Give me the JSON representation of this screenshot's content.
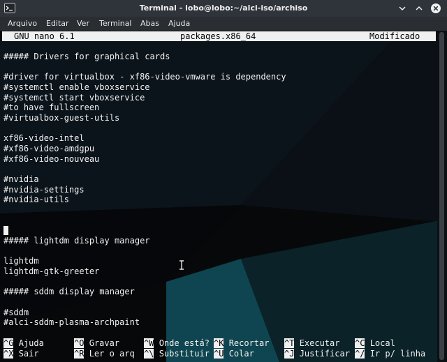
{
  "window": {
    "title": "Terminal - lobo@lobo:~/alci-iso/archiso"
  },
  "menubar": {
    "items": [
      "Arquivo",
      "Editar",
      "Ver",
      "Terminal",
      "Abas",
      "Ajuda"
    ]
  },
  "nano": {
    "version": "GNU nano 6.1",
    "filename": "packages.x86_64",
    "status": "Modificado"
  },
  "file_lines": [
    "##### Drivers for graphical cards",
    "",
    "#driver for virtualbox - xf86-video-vmware is dependency",
    "#systemctl enable vboxservice",
    "#systemctl start vboxservice",
    "#to have fullscreen",
    "#virtualbox-guest-utils",
    "",
    "xf86-video-intel",
    "#xf86-video-amdgpu",
    "#xf86-video-nouveau",
    "",
    "#nvidia",
    "#nvidia-settings",
    "#nvidia-utils",
    "",
    "",
    "",
    "##### lightdm display manager",
    "",
    "lightdm",
    "lightdm-gtk-greeter",
    "",
    "##### sddm display manager",
    "",
    "#sddm",
    "#alci-sddm-plasma-archpaint"
  ],
  "shortcuts": {
    "row1": [
      {
        "key": "^G",
        "label": "Ajuda"
      },
      {
        "key": "^O",
        "label": "Gravar"
      },
      {
        "key": "^W",
        "label": "Onde está?"
      },
      {
        "key": "^K",
        "label": "Recortar"
      },
      {
        "key": "^T",
        "label": "Executar"
      },
      {
        "key": "^C",
        "label": "Local"
      }
    ],
    "row2": [
      {
        "key": "^X",
        "label": "Sair"
      },
      {
        "key": "^R",
        "label": "Ler o arq"
      },
      {
        "key": "^\\",
        "label": "Substituir"
      },
      {
        "key": "^U",
        "label": "Colar"
      },
      {
        "key": "^J",
        "label": "Justificar"
      },
      {
        "key": "^/",
        "label": "Ir p/ linha"
      }
    ]
  },
  "colors": {
    "titlebar": "#2f343a",
    "terminal_bg": "#07090b",
    "wallpaper_teal": "#0f4550",
    "text": "#f2f2f2"
  },
  "icons": [
    "terminal-app-icon",
    "chevron-down-icon",
    "chevron-up-icon",
    "close-icon",
    "text-cursor-icon"
  ]
}
